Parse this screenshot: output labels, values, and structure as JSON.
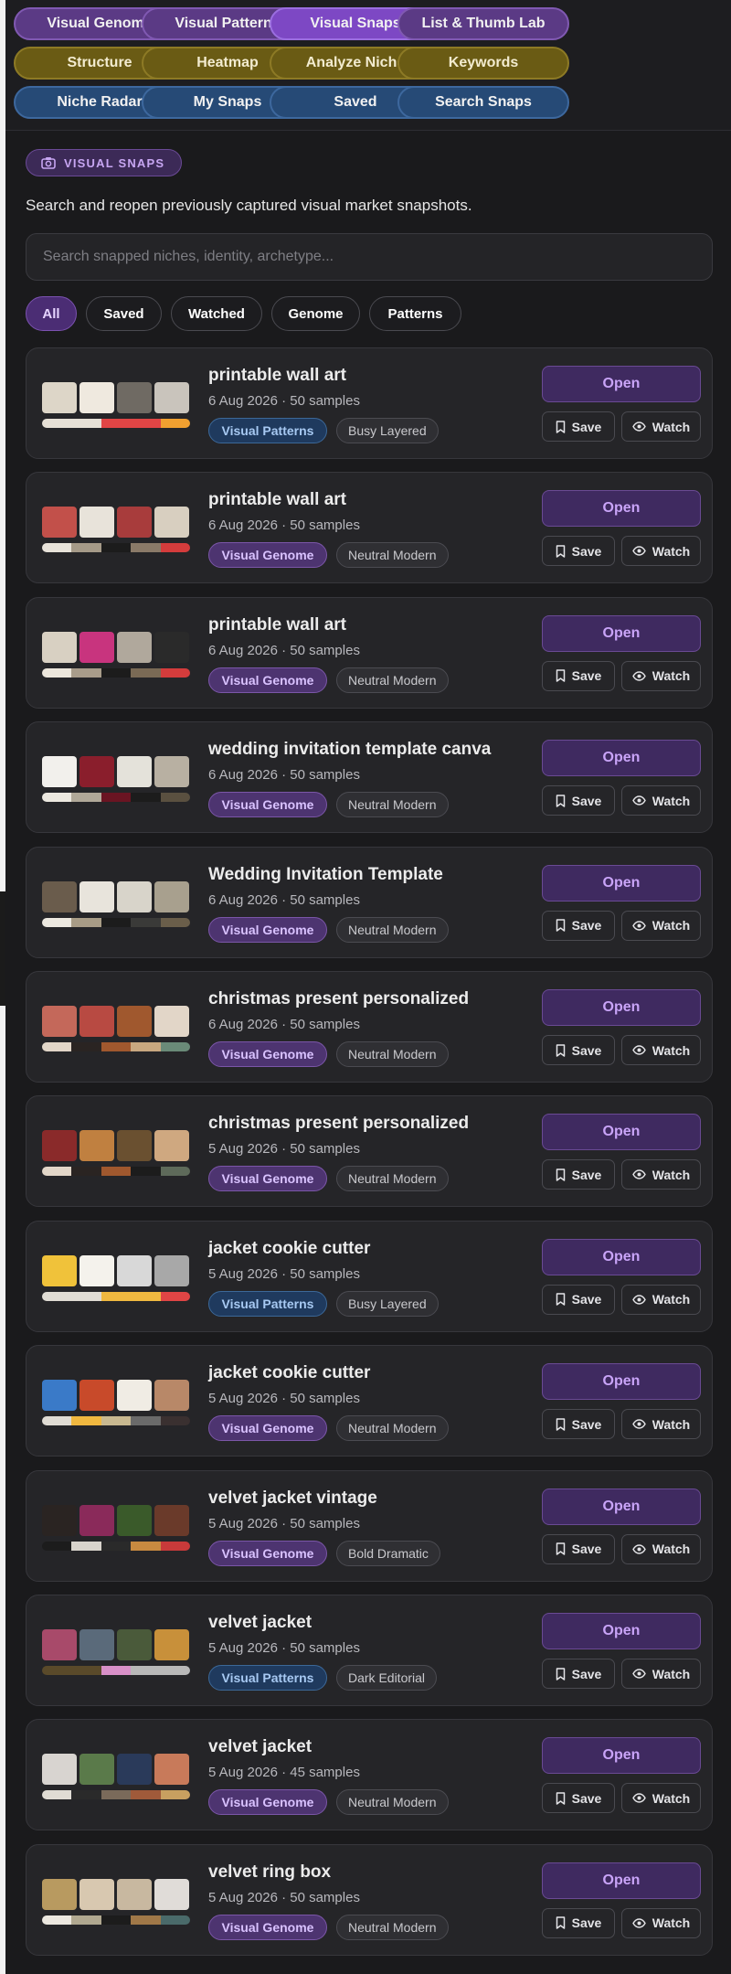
{
  "nav": [
    [
      "Visual Genome",
      "purple",
      false
    ],
    [
      "Visual Patterns",
      "purple",
      false
    ],
    [
      "Visual Snaps",
      "purple",
      true
    ],
    [
      "List & Thumb Lab",
      "purple",
      false
    ],
    [
      "Structure",
      "olive",
      false
    ],
    [
      "Heatmap",
      "olive",
      false
    ],
    [
      "Analyze Niche",
      "olive",
      false
    ],
    [
      "Keywords",
      "olive",
      false
    ],
    [
      "Niche Radar",
      "blue",
      false
    ],
    [
      "My Snaps",
      "blue",
      false
    ],
    [
      "Saved",
      "blue",
      false
    ],
    [
      "Search Snaps",
      "blue",
      false
    ]
  ],
  "badge": "VISUAL SNAPS",
  "subtitle": "Search and reopen previously captured visual market snapshots.",
  "search_placeholder": "Search snapped niches, identity, archetype...",
  "filters": [
    {
      "label": "All",
      "active": true
    },
    {
      "label": "Saved",
      "active": false
    },
    {
      "label": "Watched",
      "active": false
    },
    {
      "label": "Genome",
      "active": false
    },
    {
      "label": "Patterns",
      "active": false
    }
  ],
  "buttons": {
    "open": "Open",
    "save": "Save",
    "watch": "Watch"
  },
  "snaps": [
    {
      "title": "printable wall art",
      "meta": "6 Aug 2026 · 50 samples",
      "source": "Visual Patterns",
      "style": "Busy Layered",
      "thumbs": [
        "#ddd6c8",
        "#efe9df",
        "#6f6a63",
        "#c9c4bc"
      ],
      "palette": [
        "#e6e0d6",
        "#e6e0d6",
        "#e04545",
        "#e04545",
        "#f0a030"
      ]
    },
    {
      "title": "printable wall art",
      "meta": "6 Aug 2026 · 50 samples",
      "source": "Visual Genome",
      "style": "Neutral Modern",
      "thumbs": [
        "#c2504a",
        "#e8e3da",
        "#a83c3c",
        "#d8cfc0"
      ],
      "palette": [
        "#e8e3da",
        "#a59a88",
        "#1c1c1c",
        "#8a7a68",
        "#d43c3c"
      ]
    },
    {
      "title": "printable wall art",
      "meta": "6 Aug 2026 · 50 samples",
      "source": "Visual Genome",
      "style": "Neutral Modern",
      "thumbs": [
        "#d8d0c2",
        "#c8347e",
        "#b0a89c",
        "#2a2a2a"
      ],
      "palette": [
        "#ece6dc",
        "#a89c8a",
        "#1c1c1c",
        "#7a6a55",
        "#d43c3c"
      ]
    },
    {
      "title": "wedding invitation template canva",
      "meta": "6 Aug 2026 · 50 samples",
      "source": "Visual Genome",
      "style": "Neutral Modern",
      "thumbs": [
        "#f2f0ec",
        "#8a1e2c",
        "#e4e2da",
        "#b8b0a2"
      ],
      "palette": [
        "#ece8e0",
        "#b0a898",
        "#6a1422",
        "#1c1c1c",
        "#5a5040"
      ]
    },
    {
      "title": "Wedding Invitation Template",
      "meta": "6 Aug 2026 · 50 samples",
      "source": "Visual Genome",
      "style": "Neutral Modern",
      "thumbs": [
        "#6a5c4c",
        "#e8e4dc",
        "#d8d4ca",
        "#a8a08e"
      ],
      "palette": [
        "#ece8e0",
        "#a89c86",
        "#1c1c1c",
        "#3a3a38",
        "#6a5e4a"
      ]
    },
    {
      "title": "christmas present personalized",
      "meta": "6 Aug 2026 · 50 samples",
      "source": "Visual Genome",
      "style": "Neutral Modern",
      "thumbs": [
        "#c4685a",
        "#b84a42",
        "#a0582e",
        "#e2d6c8"
      ],
      "palette": [
        "#e2d6c8",
        "#2a2422",
        "#a0582e",
        "#c8a880",
        "#6a8a78"
      ]
    },
    {
      "title": "christmas present personalized",
      "meta": "5 Aug 2026 · 50 samples",
      "source": "Visual Genome",
      "style": "Neutral Modern",
      "thumbs": [
        "#8a2a2a",
        "#c08040",
        "#6a5030",
        "#cfa880"
      ],
      "palette": [
        "#e2d6c8",
        "#2a2422",
        "#a0582e",
        "#1c1c1c",
        "#5e6a5a"
      ]
    },
    {
      "title": "jacket cookie cutter",
      "meta": "5 Aug 2026 · 50 samples",
      "source": "Visual Patterns",
      "style": "Busy Layered",
      "thumbs": [
        "#f0c23a",
        "#f4f2ec",
        "#d8d8d8",
        "#a8a8a8"
      ],
      "palette": [
        "#e0dcd4",
        "#e0dcd4",
        "#f0b840",
        "#f0b840",
        "#e04545"
      ]
    },
    {
      "title": "jacket cookie cutter",
      "meta": "5 Aug 2026 · 50 samples",
      "source": "Visual Genome",
      "style": "Neutral Modern",
      "thumbs": [
        "#3a7ac8",
        "#c84a2a",
        "#f0ece4",
        "#b88868"
      ],
      "palette": [
        "#e0dcd4",
        "#f0b840",
        "#c8b890",
        "#6a6a6a",
        "#3a3030"
      ]
    },
    {
      "title": "velvet jacket vintage",
      "meta": "5 Aug 2026 · 50 samples",
      "source": "Visual Genome",
      "style": "Bold Dramatic",
      "thumbs": [
        "#2a2422",
        "#8a2a5a",
        "#3a5a2a",
        "#6a3a2a"
      ],
      "palette": [
        "#1c1c1c",
        "#d8d4cc",
        "#2a2a2a",
        "#c88a40",
        "#c83a3a"
      ]
    },
    {
      "title": "velvet jacket",
      "meta": "5 Aug 2026 · 50 samples",
      "source": "Visual Patterns",
      "style": "Dark Editorial",
      "thumbs": [
        "#a84a6a",
        "#5a6a7a",
        "#4a5a3a",
        "#c8903a"
      ],
      "palette": [
        "#5a4a2a",
        "#5a4a2a",
        "#d890c8",
        "#b8b8b8",
        "#b8b8b8"
      ]
    },
    {
      "title": "velvet jacket",
      "meta": "5 Aug 2026 · 45 samples",
      "source": "Visual Genome",
      "style": "Neutral Modern",
      "thumbs": [
        "#d8d4d0",
        "#5a7a4a",
        "#2a3a5a",
        "#c87a5a"
      ],
      "palette": [
        "#e0dcd4",
        "#2a2a2a",
        "#7a6a5a",
        "#a05a3a",
        "#c8a060"
      ]
    },
    {
      "title": "velvet ring box",
      "meta": "5 Aug 2026 · 50 samples",
      "source": "Visual Genome",
      "style": "Neutral Modern",
      "thumbs": [
        "#b89a60",
        "#d8c8b0",
        "#c8b8a0",
        "#e0dcd8"
      ],
      "palette": [
        "#ece8e0",
        "#b0a890",
        "#1c1c1c",
        "#a07848",
        "#4a6a6a"
      ]
    }
  ]
}
